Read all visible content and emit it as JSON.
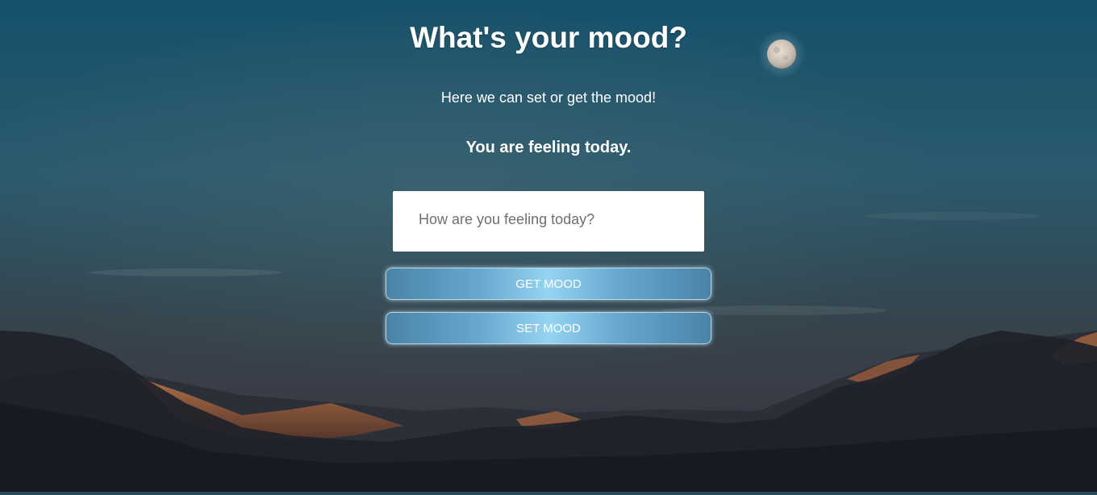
{
  "page": {
    "title": "What's your mood?",
    "subtitle": "Here we can set or get the mood!",
    "status": "You are feeling today."
  },
  "mood_input": {
    "value": "",
    "placeholder": "How are you feeling today?"
  },
  "buttons": {
    "get_label": "GET MOOD",
    "set_label": "SET MOOD"
  },
  "background": {
    "scene": "night-sky-moon-mountains",
    "colors": {
      "sky_top": "#1a4a66",
      "sky_bottom": "#3a3a44",
      "mountain": "#1c2028",
      "sunlit_ridge": "#b8683e",
      "moon": "#d8cfc4"
    }
  },
  "theme": {
    "button_gradient_edge": "#4a83a8",
    "button_gradient_center": "#96d4f2",
    "text": "#ffffff"
  }
}
